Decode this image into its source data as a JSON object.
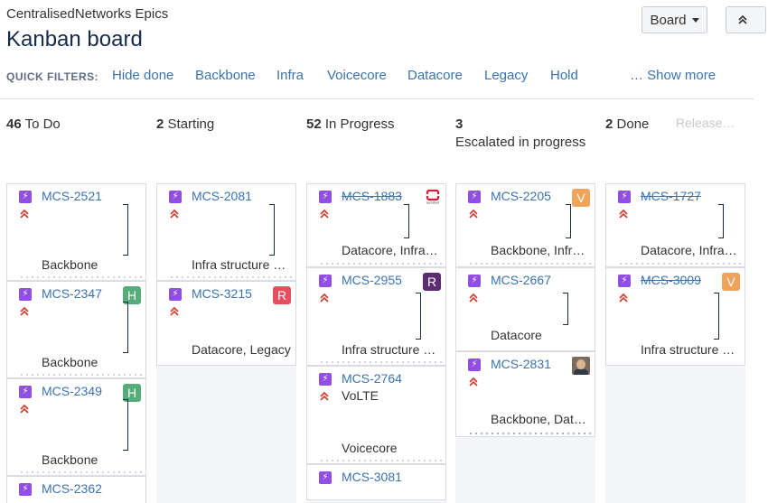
{
  "header": {
    "project": "CentralisedNetworks Epics",
    "title": "Kanban board",
    "board_button": "Board",
    "collapse_icon": "double-chevron-up"
  },
  "quick_filters": {
    "label": "QUICK FILTERS:",
    "items": [
      "Hide done",
      "Backbone",
      "Infra",
      "Voicecore",
      "Datacore",
      "Legacy",
      "Hold"
    ],
    "show_more": "… Show more"
  },
  "columns": [
    {
      "count": "46",
      "name": "To Do"
    },
    {
      "count": "2",
      "name": "Starting"
    },
    {
      "count": "52",
      "name": "In Progress"
    },
    {
      "count": "3",
      "name": "Escalated in progress"
    },
    {
      "count": "2",
      "name": "Done",
      "extra": "Release…"
    }
  ],
  "colors": {
    "epic": "#904ee2",
    "priority": "#d04437",
    "link": "#3b73af"
  },
  "cards": {
    "todo": [
      {
        "key": "MCS-2521",
        "labels": "Backbone"
      },
      {
        "key": "MCS-2347",
        "labels": "Backbone",
        "badge": "H"
      },
      {
        "key": "MCS-2349",
        "labels": "Backbone",
        "badge": "H"
      },
      {
        "key": "MCS-2362"
      }
    ],
    "starting": [
      {
        "key": "MCS-2081",
        "labels": "Infra structure s..."
      },
      {
        "key": "MCS-3215",
        "labels": "Datacore, Legacy",
        "badge": "R"
      }
    ],
    "inprogress": [
      {
        "key": "MCS-1883",
        "labels": "Datacore, Infra ...",
        "icon": "openstack-logo",
        "icon_text": "openstack"
      },
      {
        "key": "MCS-2955",
        "labels": "Infra structure s...",
        "badge": "R"
      },
      {
        "key": "MCS-2764",
        "summary": "VoLTE",
        "labels": "Voicecore"
      },
      {
        "key": "MCS-3081"
      }
    ],
    "escalated": [
      {
        "key": "MCS-2205",
        "labels": "Backbone, Infra ...",
        "badge": "V"
      },
      {
        "key": "MCS-2667",
        "labels": "Datacore"
      },
      {
        "key": "MCS-2831",
        "labels": "Backbone, Data...",
        "icon": "user-avatar"
      }
    ],
    "done": [
      {
        "key": "MCS-1727",
        "labels": "Datacore, Infra ..."
      },
      {
        "key": "MCS-3009",
        "labels": "Infra structure s...",
        "badge": "V"
      }
    ]
  }
}
